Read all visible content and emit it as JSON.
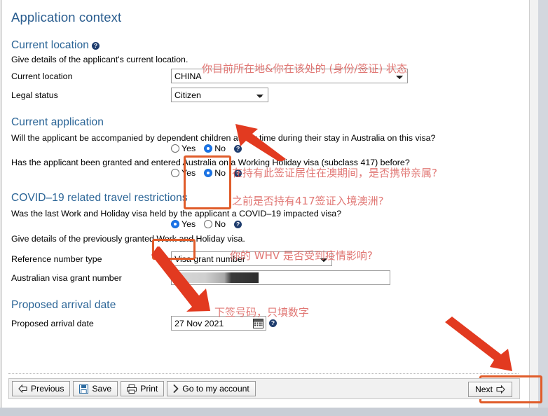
{
  "page": {
    "title": "Application context"
  },
  "sections": {
    "current_location": {
      "heading": "Current location",
      "help_icon": "help-icon",
      "description": "Give details of the applicant's current location.",
      "annotation_cn": "你目前所在地&你在该处的 (身份/签证) 状态",
      "fields": {
        "current_location": {
          "label": "Current location",
          "value": "CHINA"
        },
        "legal_status": {
          "label": "Legal status",
          "value": "Citizen"
        }
      }
    },
    "current_application": {
      "heading": "Current application",
      "questions": [
        {
          "text": "Will the applicant be accompanied by dependent children at any time during their stay in Australia on this visa?",
          "yes_label": "Yes",
          "no_label": "No",
          "selected": "No",
          "annotation_cn": "在持有此签证居住在澳期间，是否携带亲属?"
        },
        {
          "text": "Has the applicant been granted and entered Australia on a Working Holiday visa (subclass 417) before?",
          "yes_label": "Yes",
          "no_label": "No",
          "selected": "No",
          "annotation_cn": "之前是否持有417签证入境澳洲?"
        }
      ]
    },
    "covid": {
      "heading": "COVID–19 related travel restrictions",
      "question": {
        "text": "Was the last Work and Holiday visa held by the applicant a COVID–19 impacted visa?",
        "yes_label": "Yes",
        "no_label": "No",
        "selected": "Yes",
        "annotation_cn": "你的 WHV 是否受到疫情影响?"
      },
      "description": "Give details of the previously granted Work and Holiday visa.",
      "fields": {
        "reference_number_type": {
          "label": "Reference number type",
          "value": "Visa grant number"
        },
        "visa_grant_number": {
          "label": "Australian visa grant number",
          "value": "",
          "redacted": true,
          "annotation_cn": "下签号码，只填数字"
        }
      }
    },
    "arrival": {
      "heading": "Proposed arrival date",
      "field": {
        "label": "Proposed arrival date",
        "value": "27 Nov 2021",
        "calendar_icon": "calendar-icon",
        "help_icon": "help-icon"
      }
    }
  },
  "toolbar": {
    "previous_label": "Previous",
    "save_label": "Save",
    "print_label": "Print",
    "account_label": "Go to my account",
    "next_label": "Next"
  },
  "colors": {
    "heading_blue": "#2a6496",
    "annotation_red": "#d9534f",
    "highlight_orange": "#e05c2a",
    "radio_blue": "#1a73e8"
  }
}
